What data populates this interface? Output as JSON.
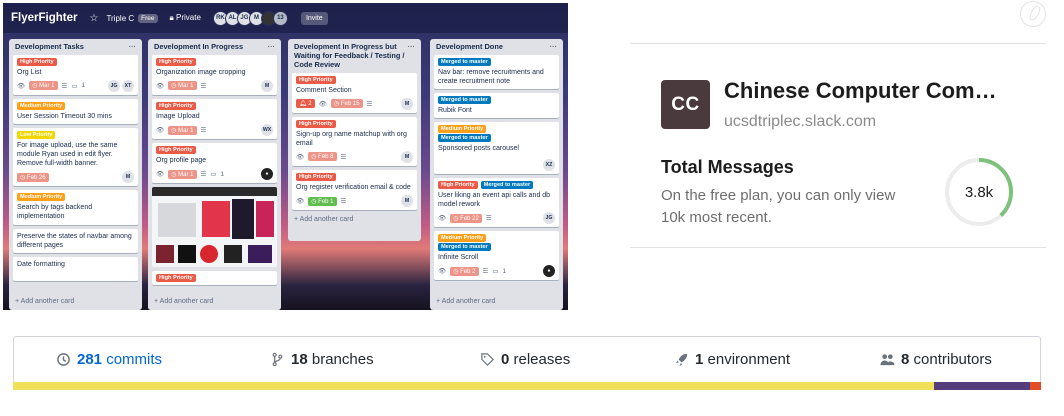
{
  "trello": {
    "logo": "FlyerFighter",
    "team": "Triple C",
    "team_badge": "Free",
    "visibility": "Private",
    "avatars": [
      "RK",
      "AL",
      "JG",
      "M"
    ],
    "avatar_count": "13",
    "invite": "Invite",
    "lists": [
      {
        "title": "Development Tasks",
        "cards": [
          {
            "labels": [
              {
                "text": "High Priority",
                "color": "#eb5a46"
              }
            ],
            "title": "Org List",
            "due": "Mar 1",
            "comments": "1",
            "members": [
              "JG",
              "XT"
            ]
          },
          {
            "labels": [
              {
                "text": "Medium Priority",
                "color": "#ff9f1a"
              }
            ],
            "title": "User Session Timeout 30 mins"
          },
          {
            "labels": [
              {
                "text": "Low Priority",
                "color": "#f2d600"
              }
            ],
            "title": "For image upload, use the same module Ryan used in edit flyer. Remove full-width banner.",
            "due": "Feb 26",
            "members": [
              "M"
            ]
          },
          {
            "labels": [
              {
                "text": "Medium Priority",
                "color": "#ff9f1a"
              }
            ],
            "title": "Search by tags backend implementation"
          },
          {
            "labels": [],
            "title": "Preserve the states of navbar among different pages"
          },
          {
            "labels": [],
            "title": "Date formatting"
          }
        ],
        "add": "+ Add another card"
      },
      {
        "title": "Development In Progress",
        "cards": [
          {
            "labels": [
              {
                "text": "High Priority",
                "color": "#eb5a46"
              }
            ],
            "title": "Organization image cropping",
            "due": "Mar 1",
            "members": [
              "M"
            ]
          },
          {
            "labels": [
              {
                "text": "High Priority",
                "color": "#eb5a46"
              }
            ],
            "title": "Image Upload",
            "due": "Mar 1",
            "members": [
              "WX"
            ]
          },
          {
            "labels": [
              {
                "text": "High Priority",
                "color": "#eb5a46"
              }
            ],
            "title": "Org profile page",
            "due": "Mar 1",
            "comments": "1",
            "members": [
              "photo"
            ]
          },
          {
            "labels": [
              {
                "text": "High Priority",
                "color": "#eb5a46"
              }
            ],
            "title": ""
          }
        ],
        "add": "+ Add another card"
      },
      {
        "title": "Development In Progress but Waiting for Feedback / Testing / Code Review",
        "cards": [
          {
            "labels": [
              {
                "text": "High Priority",
                "color": "#eb5a46"
              }
            ],
            "title": "Comment Section",
            "alerts": "2",
            "due": "Feb 15",
            "members": [
              "M"
            ]
          },
          {
            "labels": [
              {
                "text": "High Priority",
                "color": "#eb5a46"
              }
            ],
            "title": "Sign-up org name matchup with org email",
            "due": "Feb 8",
            "members": [
              "M"
            ]
          },
          {
            "labels": [
              {
                "text": "High Priority",
                "color": "#eb5a46"
              }
            ],
            "title": "Org register verification email & code",
            "due": "Feb 1",
            "members": [
              "M"
            ]
          }
        ],
        "add": "+ Add another card"
      },
      {
        "title": "Development Done",
        "cards": [
          {
            "labels": [
              {
                "text": "Merged to master",
                "color": "#0079bf"
              }
            ],
            "title": "Nav bar: remove recruitments and create recruitment note"
          },
          {
            "labels": [
              {
                "text": "Merged to master",
                "color": "#0079bf"
              }
            ],
            "title": "Rubik Font"
          },
          {
            "labels": [
              {
                "text": "Medium Priority",
                "color": "#ff9f1a"
              },
              {
                "text": "Merged to master",
                "color": "#0079bf"
              }
            ],
            "title": "Sponsored posts carousel",
            "members": [
              "XZ"
            ]
          },
          {
            "labels": [
              {
                "text": "High Priority",
                "color": "#eb5a46"
              },
              {
                "text": "Merged to master",
                "color": "#0079bf"
              }
            ],
            "title": "User liking an event api calls and db model rework",
            "due": "Feb 22",
            "members": [
              "JG"
            ]
          },
          {
            "labels": [
              {
                "text": "Medium Priority",
                "color": "#ff9f1a"
              },
              {
                "text": "Merged to master",
                "color": "#0079bf"
              }
            ],
            "title": "Infinite Scroll",
            "due": "Feb 2",
            "comments": "1",
            "members": [
              "photo"
            ]
          }
        ],
        "add": "+ Add another card"
      }
    ]
  },
  "slack": {
    "logo_text": "CC",
    "workspace_name": "Chinese Computer Com…",
    "domain": "ucsdtriplec.slack.com",
    "total_messages_title": "Total Messages",
    "total_messages_desc": "On the free plan, you can only view 10k most recent.",
    "total_messages_value": "3.8k",
    "usage_fraction": 0.38,
    "ring_color": "#7ec17a"
  },
  "github": {
    "commits_count": "281",
    "commits_label": "commits",
    "branches_count": "18",
    "branches_label": "branches",
    "releases_count": "0",
    "releases_label": "releases",
    "environments_count": "1",
    "environments_label": "environment",
    "contributors_count": "8",
    "contributors_label": "contributors",
    "languages": [
      {
        "color": "#f1e05a",
        "fraction": 0.896
      },
      {
        "color": "#563d7c",
        "fraction": 0.093
      },
      {
        "color": "#e34c26",
        "fraction": 0.011
      }
    ]
  }
}
